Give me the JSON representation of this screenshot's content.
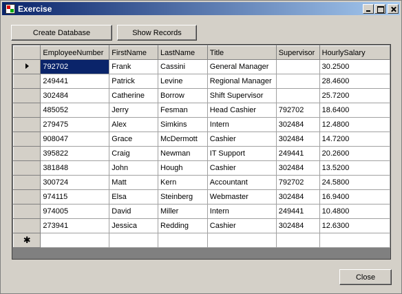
{
  "window": {
    "title": "Exercise"
  },
  "toolbar": {
    "create_label": "Create Database",
    "show_label": "Show Records"
  },
  "footer": {
    "close_label": "Close"
  },
  "grid": {
    "columns": [
      "EmployeeNumber",
      "FirstName",
      "LastName",
      "Title",
      "Supervisor",
      "HourlySalary"
    ],
    "rows": [
      [
        "792702",
        "Frank",
        "Cassini",
        "General Manager",
        "",
        "30.2500"
      ],
      [
        "249441",
        "Patrick",
        "Levine",
        "Regional Manager",
        "",
        "28.4600"
      ],
      [
        "302484",
        "Catherine",
        "Borrow",
        "Shift Supervisor",
        "",
        "25.7200"
      ],
      [
        "485052",
        "Jerry",
        "Fesman",
        "Head Cashier",
        "792702",
        "18.6400"
      ],
      [
        "279475",
        "Alex",
        "Simkins",
        "Intern",
        "302484",
        "12.4800"
      ],
      [
        "908047",
        "Grace",
        "McDermott",
        "Cashier",
        "302484",
        "14.7200"
      ],
      [
        "395822",
        "Craig",
        "Newman",
        "IT Support",
        "249441",
        "20.2600"
      ],
      [
        "381848",
        "John",
        "Hough",
        "Cashier",
        "302484",
        "13.5200"
      ],
      [
        "300724",
        "Matt",
        "Kern",
        "Accountant",
        "792702",
        "24.5800"
      ],
      [
        "974115",
        "Elsa",
        "Steinberg",
        "Webmaster",
        "302484",
        "16.9400"
      ],
      [
        "974005",
        "David",
        "Miller",
        "Intern",
        "249441",
        "10.4800"
      ],
      [
        "273941",
        "Jessica",
        "Redding",
        "Cashier",
        "302484",
        "12.6300"
      ]
    ],
    "new_row_marker": "✱"
  }
}
